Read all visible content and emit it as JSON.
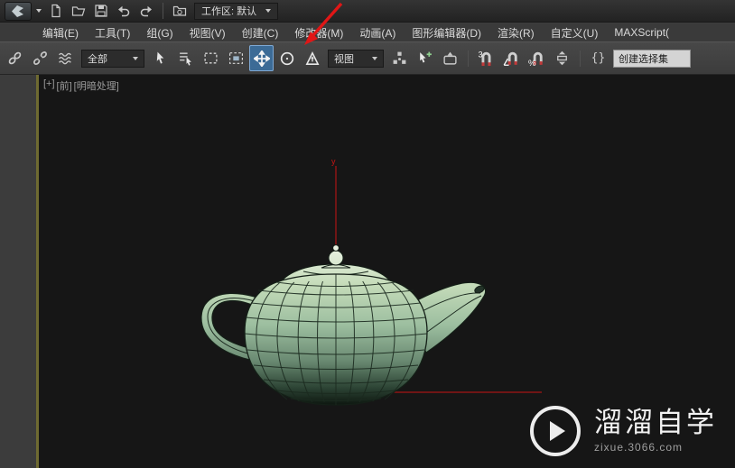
{
  "titlebar": {
    "workspace_label": "工作区: 默认"
  },
  "menubar": {
    "items": [
      "编辑(E)",
      "工具(T)",
      "组(G)",
      "视图(V)",
      "创建(C)",
      "修改器(M)",
      "动画(A)",
      "图形编辑器(D)",
      "渲染(R)",
      "自定义(U)",
      "MAXScript("
    ]
  },
  "toolbar": {
    "selection_filter_value": "全部",
    "coordinate_system_value": "视图",
    "snap_3d_label": "3",
    "percent_snap_label": "%",
    "edit_named_sets_glyph": "{}",
    "named_selection_value": "创建选择集"
  },
  "viewport": {
    "label_maximize": "[+]",
    "label_view": "[前]",
    "label_shading": "[明暗处理]",
    "axis_y_label": "y"
  },
  "watermark": {
    "brand": "溜溜自学",
    "url": "zixue.3066.com"
  },
  "colors": {
    "active_tool_bg": "#3c6b96",
    "axis_red": "#c81414",
    "viewport_border_olive": "#6e6a31",
    "teapot_top": "#eef5e8",
    "teapot_bottom": "#0a120c",
    "annotation_arrow": "#e01616"
  },
  "icons": {
    "quick_access": [
      "3ds-max-logo",
      "new-file-icon",
      "open-file-icon",
      "save-file-icon",
      "undo-icon",
      "redo-icon",
      "project-folder-icon"
    ],
    "toolbar": [
      "link-icon",
      "unlink-icon",
      "space-warp-icon",
      "select-object-icon",
      "select-by-name-icon",
      "rect-region-icon",
      "window-crossing-icon",
      "move-icon",
      "rotate-icon",
      "scale-icon",
      "use-center-icon",
      "manipulate-icon",
      "keyboard-override-icon",
      "snap-3d-icon",
      "angle-snap-icon",
      "percent-snap-icon",
      "spinner-snap-icon",
      "edit-named-sets-icon"
    ]
  }
}
